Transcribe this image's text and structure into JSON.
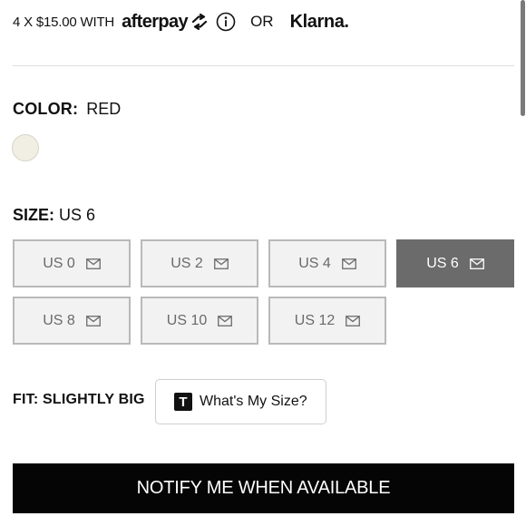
{
  "payment": {
    "installment_text": "4 X $15.00 WITH",
    "afterpay_text": "afterpay",
    "or_text": "OR",
    "klarna_text": "Klarna."
  },
  "color": {
    "label": "COLOR:",
    "value": "RED",
    "swatch_color": "#f1efe4"
  },
  "size": {
    "label": "SIZE:",
    "value": "US 6",
    "options": [
      {
        "label": "US 0",
        "selected": false
      },
      {
        "label": "US 2",
        "selected": false
      },
      {
        "label": "US 4",
        "selected": false
      },
      {
        "label": "US 6",
        "selected": true
      },
      {
        "label": "US 8",
        "selected": false
      },
      {
        "label": "US 10",
        "selected": false
      },
      {
        "label": "US 12",
        "selected": false
      }
    ]
  },
  "fit": {
    "label": "FIT: SLIGHTLY BIG",
    "button_logo": "T",
    "button_label": "What's My Size?"
  },
  "notify": {
    "label": "NOTIFY ME WHEN AVAILABLE"
  },
  "colors": {
    "selected_size_bg": "#6b6b6b",
    "primary_button_bg": "#050505"
  }
}
